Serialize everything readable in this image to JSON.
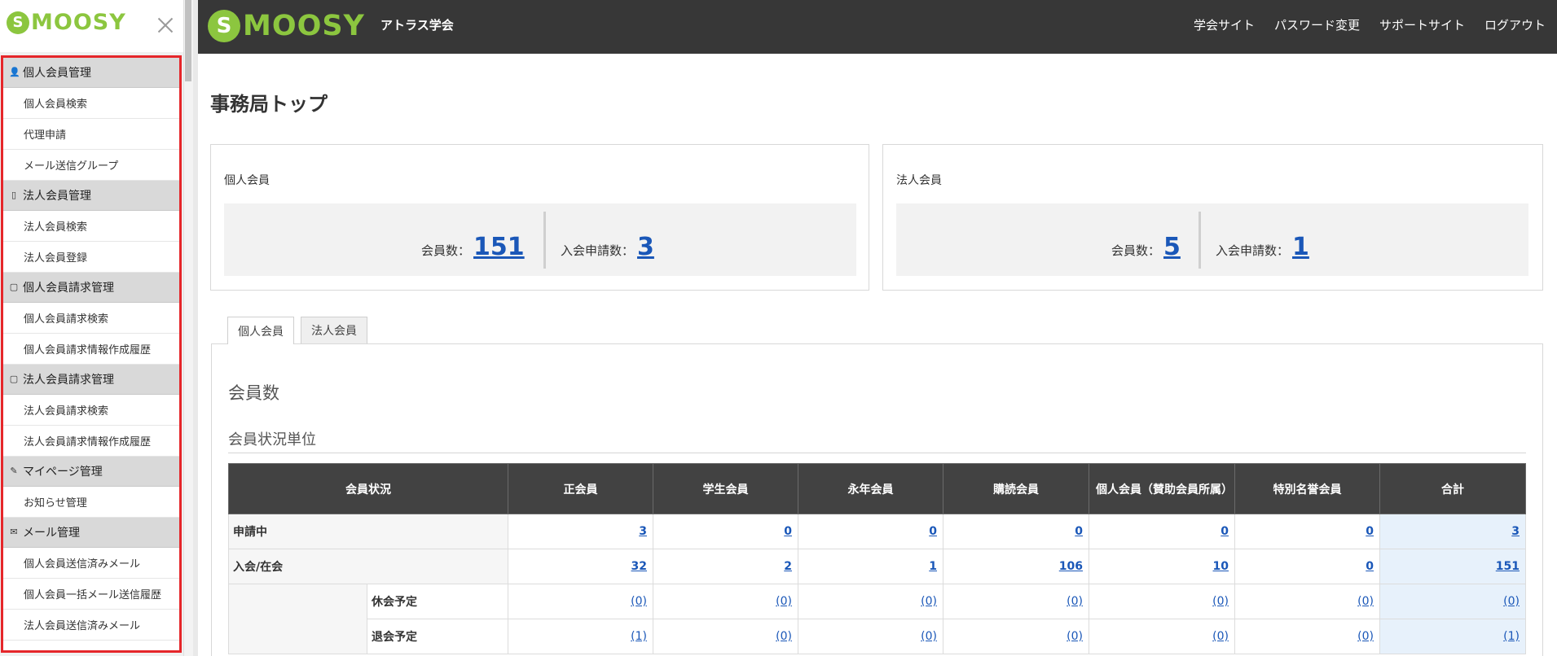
{
  "app": {
    "logo_text": "SMOOSY",
    "org_name": "アトラス学会"
  },
  "header": {
    "nav": [
      "学会サイト",
      "パスワード変更",
      "サポートサイト",
      "ログアウト"
    ]
  },
  "sidebar": {
    "sections": [
      {
        "title": "個人会員管理",
        "icon": "person-icon",
        "items": [
          "個人会員検索",
          "代理申請",
          "メール送信グループ"
        ]
      },
      {
        "title": "法人会員管理",
        "icon": "building-icon",
        "items": [
          "法人会員検索",
          "法人会員登録"
        ]
      },
      {
        "title": "個人会員請求管理",
        "icon": "document-icon",
        "items": [
          "個人会員請求検索",
          "個人会員請求情報作成履歴"
        ]
      },
      {
        "title": "法人会員請求管理",
        "icon": "document-icon",
        "items": [
          "法人会員請求検索",
          "法人会員請求情報作成履歴"
        ]
      },
      {
        "title": "マイページ管理",
        "icon": "pencil-icon",
        "items": [
          "お知らせ管理"
        ]
      },
      {
        "title": "メール管理",
        "icon": "mail-icon",
        "items": [
          "個人会員送信済みメール",
          "個人会員一括メール送信履歴",
          "法人会員送信済みメール"
        ]
      }
    ]
  },
  "main": {
    "page_title": "事務局トップ",
    "cards": [
      {
        "label": "個人会員",
        "members_label": "会員数：",
        "members_value": "151",
        "apps_label": "入会申請数：",
        "apps_value": "3"
      },
      {
        "label": "法人会員",
        "members_label": "会員数：",
        "members_value": "5",
        "apps_label": "入会申請数：",
        "apps_value": "1"
      }
    ],
    "tabs": [
      "個人会員",
      "法人会員"
    ],
    "panel_title": "会員数",
    "sub_title": "会員状況単位",
    "table": {
      "headers": [
        "会員状況",
        "正会員",
        "学生会員",
        "永年会員",
        "購読会員",
        "個人会員（賛助会員所属）",
        "特別名誉会員",
        "合計"
      ],
      "rows": [
        {
          "label": "申請中",
          "values": [
            "3",
            "0",
            "0",
            "0",
            "0",
            "0",
            "3"
          ]
        },
        {
          "label": "入会/在会",
          "values": [
            "32",
            "2",
            "1",
            "106",
            "10",
            "0",
            "151"
          ]
        },
        {
          "label": "休会予定",
          "values": [
            "(0)",
            "(0)",
            "(0)",
            "(0)",
            "(0)",
            "(0)",
            "(0)"
          ]
        },
        {
          "label": "退会予定",
          "values": [
            "(1)",
            "(0)",
            "(0)",
            "(0)",
            "(0)",
            "(0)",
            "(1)"
          ]
        }
      ]
    }
  },
  "colors": {
    "header_bg": "#373737",
    "brand_green": "#8cc63f",
    "link_blue": "#1a57b8",
    "highlight_red": "#e5262a",
    "total_bg": "#e7f1fb"
  }
}
